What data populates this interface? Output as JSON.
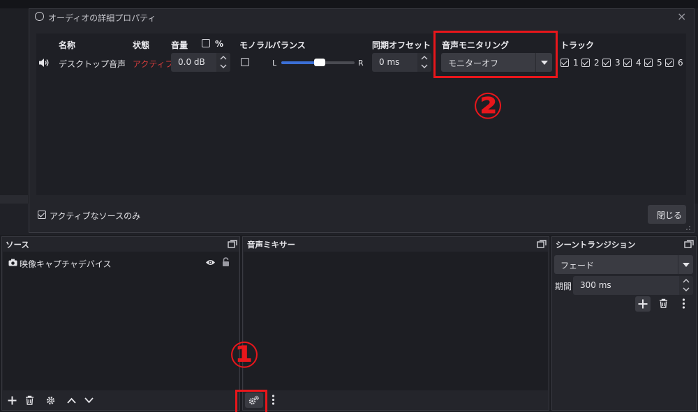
{
  "dialog": {
    "title": "オーディオの詳細プロパティ",
    "close_glyph": "×",
    "headers": {
      "name": "名称",
      "status": "状態",
      "volume": "音量",
      "percent": "%",
      "mono": "モノラル",
      "balance": "バランス",
      "sync_offset": "同期オフセット",
      "monitoring": "音声モニタリング",
      "tracks": "トラック"
    },
    "row": {
      "name": "デスクトップ音声",
      "status": "アクティブ",
      "volume": "0.0 dB",
      "balance_left": "L",
      "balance_right": "R",
      "balance_value": 0.5,
      "sync_offset": "0 ms",
      "monitoring": "モニターオフ",
      "tracks": [
        "1",
        "2",
        "3",
        "4",
        "5",
        "6"
      ]
    },
    "active_only_label": "アクティブなソースのみ",
    "close_button": "閉じる"
  },
  "annotations": {
    "circle_1": "①",
    "circle_2": "②",
    "color": "#e8161b"
  },
  "sources_panel": {
    "title": "ソース",
    "item": "映像キャプチャデバイス"
  },
  "mixer_panel": {
    "title": "音声ミキサー"
  },
  "transition_panel": {
    "title": "シーントランジション",
    "transition": "フェード",
    "duration_label": "期間",
    "duration": "300 ms"
  },
  "colors": {
    "status_active": "#d23c3c",
    "slider_fill": "#3b6fd6"
  }
}
